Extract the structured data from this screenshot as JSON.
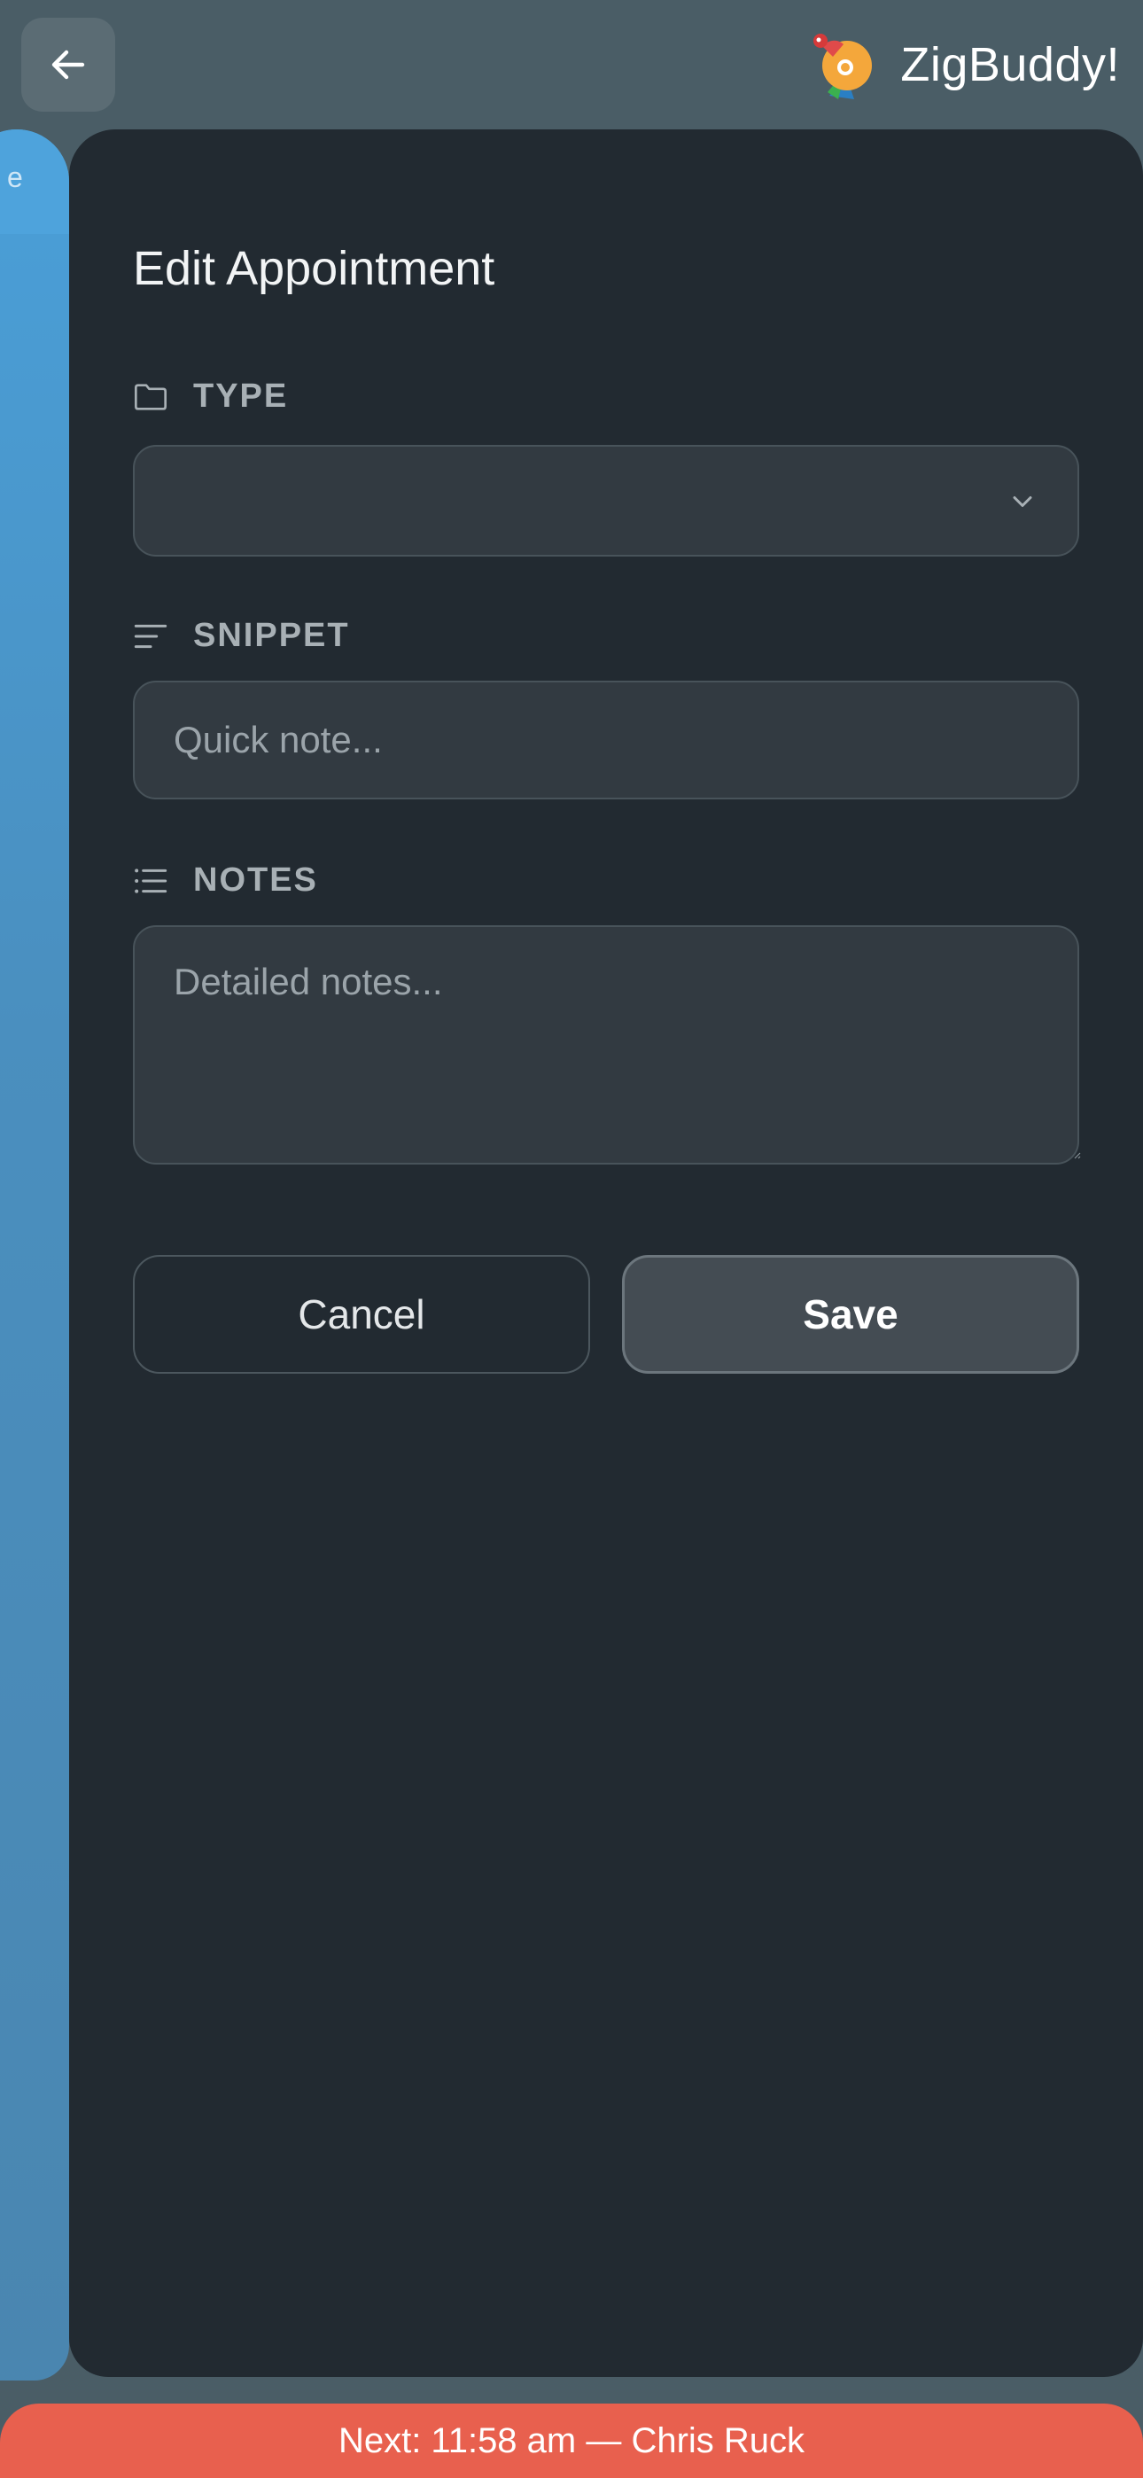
{
  "app": {
    "name": "ZigBuddy!"
  },
  "background": {
    "tab_letter": "e"
  },
  "dialog": {
    "title": "Edit Appointment",
    "type": {
      "label": "TYPE",
      "selected": ""
    },
    "snippet": {
      "label": "SNIPPET",
      "value": "",
      "placeholder": "Quick note..."
    },
    "notes": {
      "label": "NOTES",
      "value": "",
      "placeholder": "Detailed notes..."
    },
    "cancel_label": "Cancel",
    "save_label": "Save"
  },
  "banner": {
    "text": "Next: 11:58 am — Chris Ruck"
  },
  "icons": {
    "back": "arrow-left-icon",
    "logo": "bird-logo",
    "type": "folder-icon",
    "snippet": "align-left-icon",
    "notes": "list-icon",
    "dropdown": "chevron-down-icon"
  },
  "colors": {
    "sheet": "#222a31",
    "field": "#323a41",
    "banner": "#e8604e",
    "panel_blue": "#4a9fd8"
  }
}
